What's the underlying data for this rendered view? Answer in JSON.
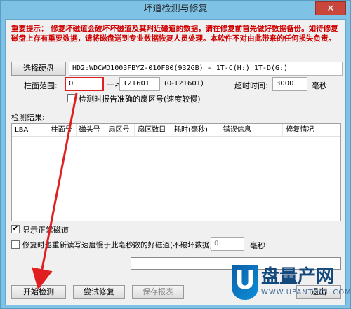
{
  "window": {
    "title": "坏道检测与修复",
    "close_glyph": "✕"
  },
  "warning": {
    "text": "重要提示： 修复坏磁道会破坏坏磁道及其附近磁道的数据，请在修复前首先做好数据备份。如待修复磁盘上存有重要数据，请将磁盘送到专业数据恢复人员处理。本软件不对由此带来的任何损失负责。"
  },
  "drive": {
    "select_label": "选择硬盘",
    "info": "HD2:WDCWD1003FBYZ-010FB0(932GB) - 1T-C(H:) 1T-D(G:)"
  },
  "range": {
    "label": "柱面范围:",
    "start": "0",
    "arrow": "—>",
    "end": "121601",
    "hint": "(0-121601)",
    "timeout_label": "超时时间:",
    "timeout_value": "3000",
    "timeout_unit": "毫秒"
  },
  "options": {
    "report_sector_label": "检测时报告准确的扇区号(速度较慢)",
    "report_sector_checked": false,
    "show_normal_label": "显示正常磁道",
    "show_normal_checked": true,
    "repair_slow_label": "修复时也重新读写速度慢于此毫秒数的好磁道(不破坏数据):",
    "repair_slow_checked": false,
    "repair_slow_value": "0",
    "repair_slow_unit": "毫秒"
  },
  "results": {
    "label": "检测结果:",
    "columns": [
      "LBA",
      "柱面号",
      "磁头号",
      "扇区号",
      "扇区数目",
      "耗时(毫秒)",
      "错误信息",
      "修复情况"
    ]
  },
  "progress": {
    "fraction": 0
  },
  "buttons": {
    "start": "开始检测",
    "try_repair": "尝试修复",
    "save_report": "保存报表",
    "exit": "退出"
  },
  "watermark": {
    "logo_letter": "U",
    "text": "盘量产网",
    "url": "WWW.UPANTOOL.COM"
  },
  "colors": {
    "annotation_red": "#e02020",
    "warning_red": "#d00000",
    "title_blue": "#7ec2e6"
  }
}
